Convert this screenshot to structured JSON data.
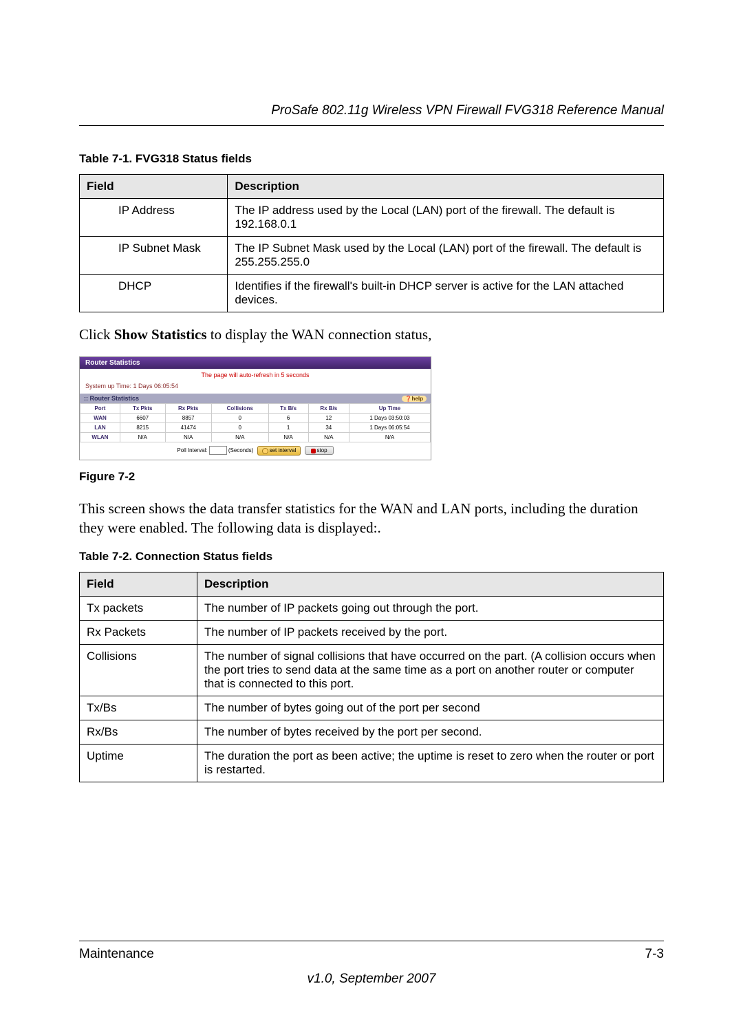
{
  "header": {
    "running_title": "ProSafe 802.11g Wireless VPN Firewall FVG318 Reference Manual"
  },
  "table1": {
    "caption": "Table 7-1.  FVG318 Status fields",
    "col_field": "Field",
    "col_desc": "Description",
    "rows": [
      {
        "field": "IP Address",
        "desc": "The IP address used by the Local (LAN) port of the firewall. The default is 192.168.0.1"
      },
      {
        "field": "IP Subnet Mask",
        "desc": "The IP Subnet Mask used by the Local (LAN) port of the firewall. The default is 255.255.255.0"
      },
      {
        "field": "DHCP",
        "desc": "Identifies if the firewall's built-in DHCP server is active for the LAN attached devices."
      }
    ]
  },
  "para1_a": "Click ",
  "para1_b": "Show Statistics",
  "para1_c": " to display the WAN connection status,",
  "router_panel": {
    "title": "Router Statistics",
    "refresh_msg": "The page will auto-refresh in 5 seconds",
    "uptime_label": "System up Time: 1 Days 06:05:54",
    "subhead": "Router Statistics",
    "help": "help",
    "headers": {
      "port": "Port",
      "tx": "Tx Pkts",
      "rx": "Rx Pkts",
      "col": "Collisions",
      "txb": "Tx B/s",
      "rxb": "Rx B/s",
      "up": "Up Time"
    },
    "rows": [
      {
        "port": "WAN",
        "tx": "6607",
        "rx": "8857",
        "col": "0",
        "txb": "6",
        "rxb": "12",
        "up": "1 Days 03:50:03"
      },
      {
        "port": "LAN",
        "tx": "8215",
        "rx": "41474",
        "col": "0",
        "txb": "1",
        "rxb": "34",
        "up": "1 Days 06:05:54"
      },
      {
        "port": "WLAN",
        "tx": "N/A",
        "rx": "N/A",
        "col": "N/A",
        "txb": "N/A",
        "rxb": "N/A",
        "up": "N/A"
      }
    ],
    "poll_label": "Poll Interval:",
    "poll_unit": "(Seconds)",
    "btn_set": "set interval",
    "btn_stop": "stop"
  },
  "figure_caption": "Figure 7-2",
  "para2": "This screen shows the data transfer statistics for the WAN and LAN ports, including the duration they were enabled. The following data is displayed:.",
  "table2": {
    "caption": "Table 7-2.  Connection Status fields",
    "col_field": "Field",
    "col_desc": "Description",
    "rows": [
      {
        "field": "Tx packets",
        "desc": "The number of IP packets going out through the port."
      },
      {
        "field": "Rx Packets",
        "desc": "The number of IP packets received by the port."
      },
      {
        "field": "Collisions",
        "desc": "The number of signal collisions that have occurred on the part. (A collision occurs when the port tries to send data at the same time as a port on another router or computer that is connected to this port."
      },
      {
        "field": "Tx/Bs",
        "desc": "The number of bytes going out of the port per second"
      },
      {
        "field": "Rx/Bs",
        "desc": "The number of bytes received by the port per second."
      },
      {
        "field": "Uptime",
        "desc": "The duration the port as been active; the uptime is reset to zero when the router or port is restarted."
      }
    ]
  },
  "footer": {
    "section": "Maintenance",
    "page": "7-3",
    "version": "v1.0, September 2007"
  }
}
